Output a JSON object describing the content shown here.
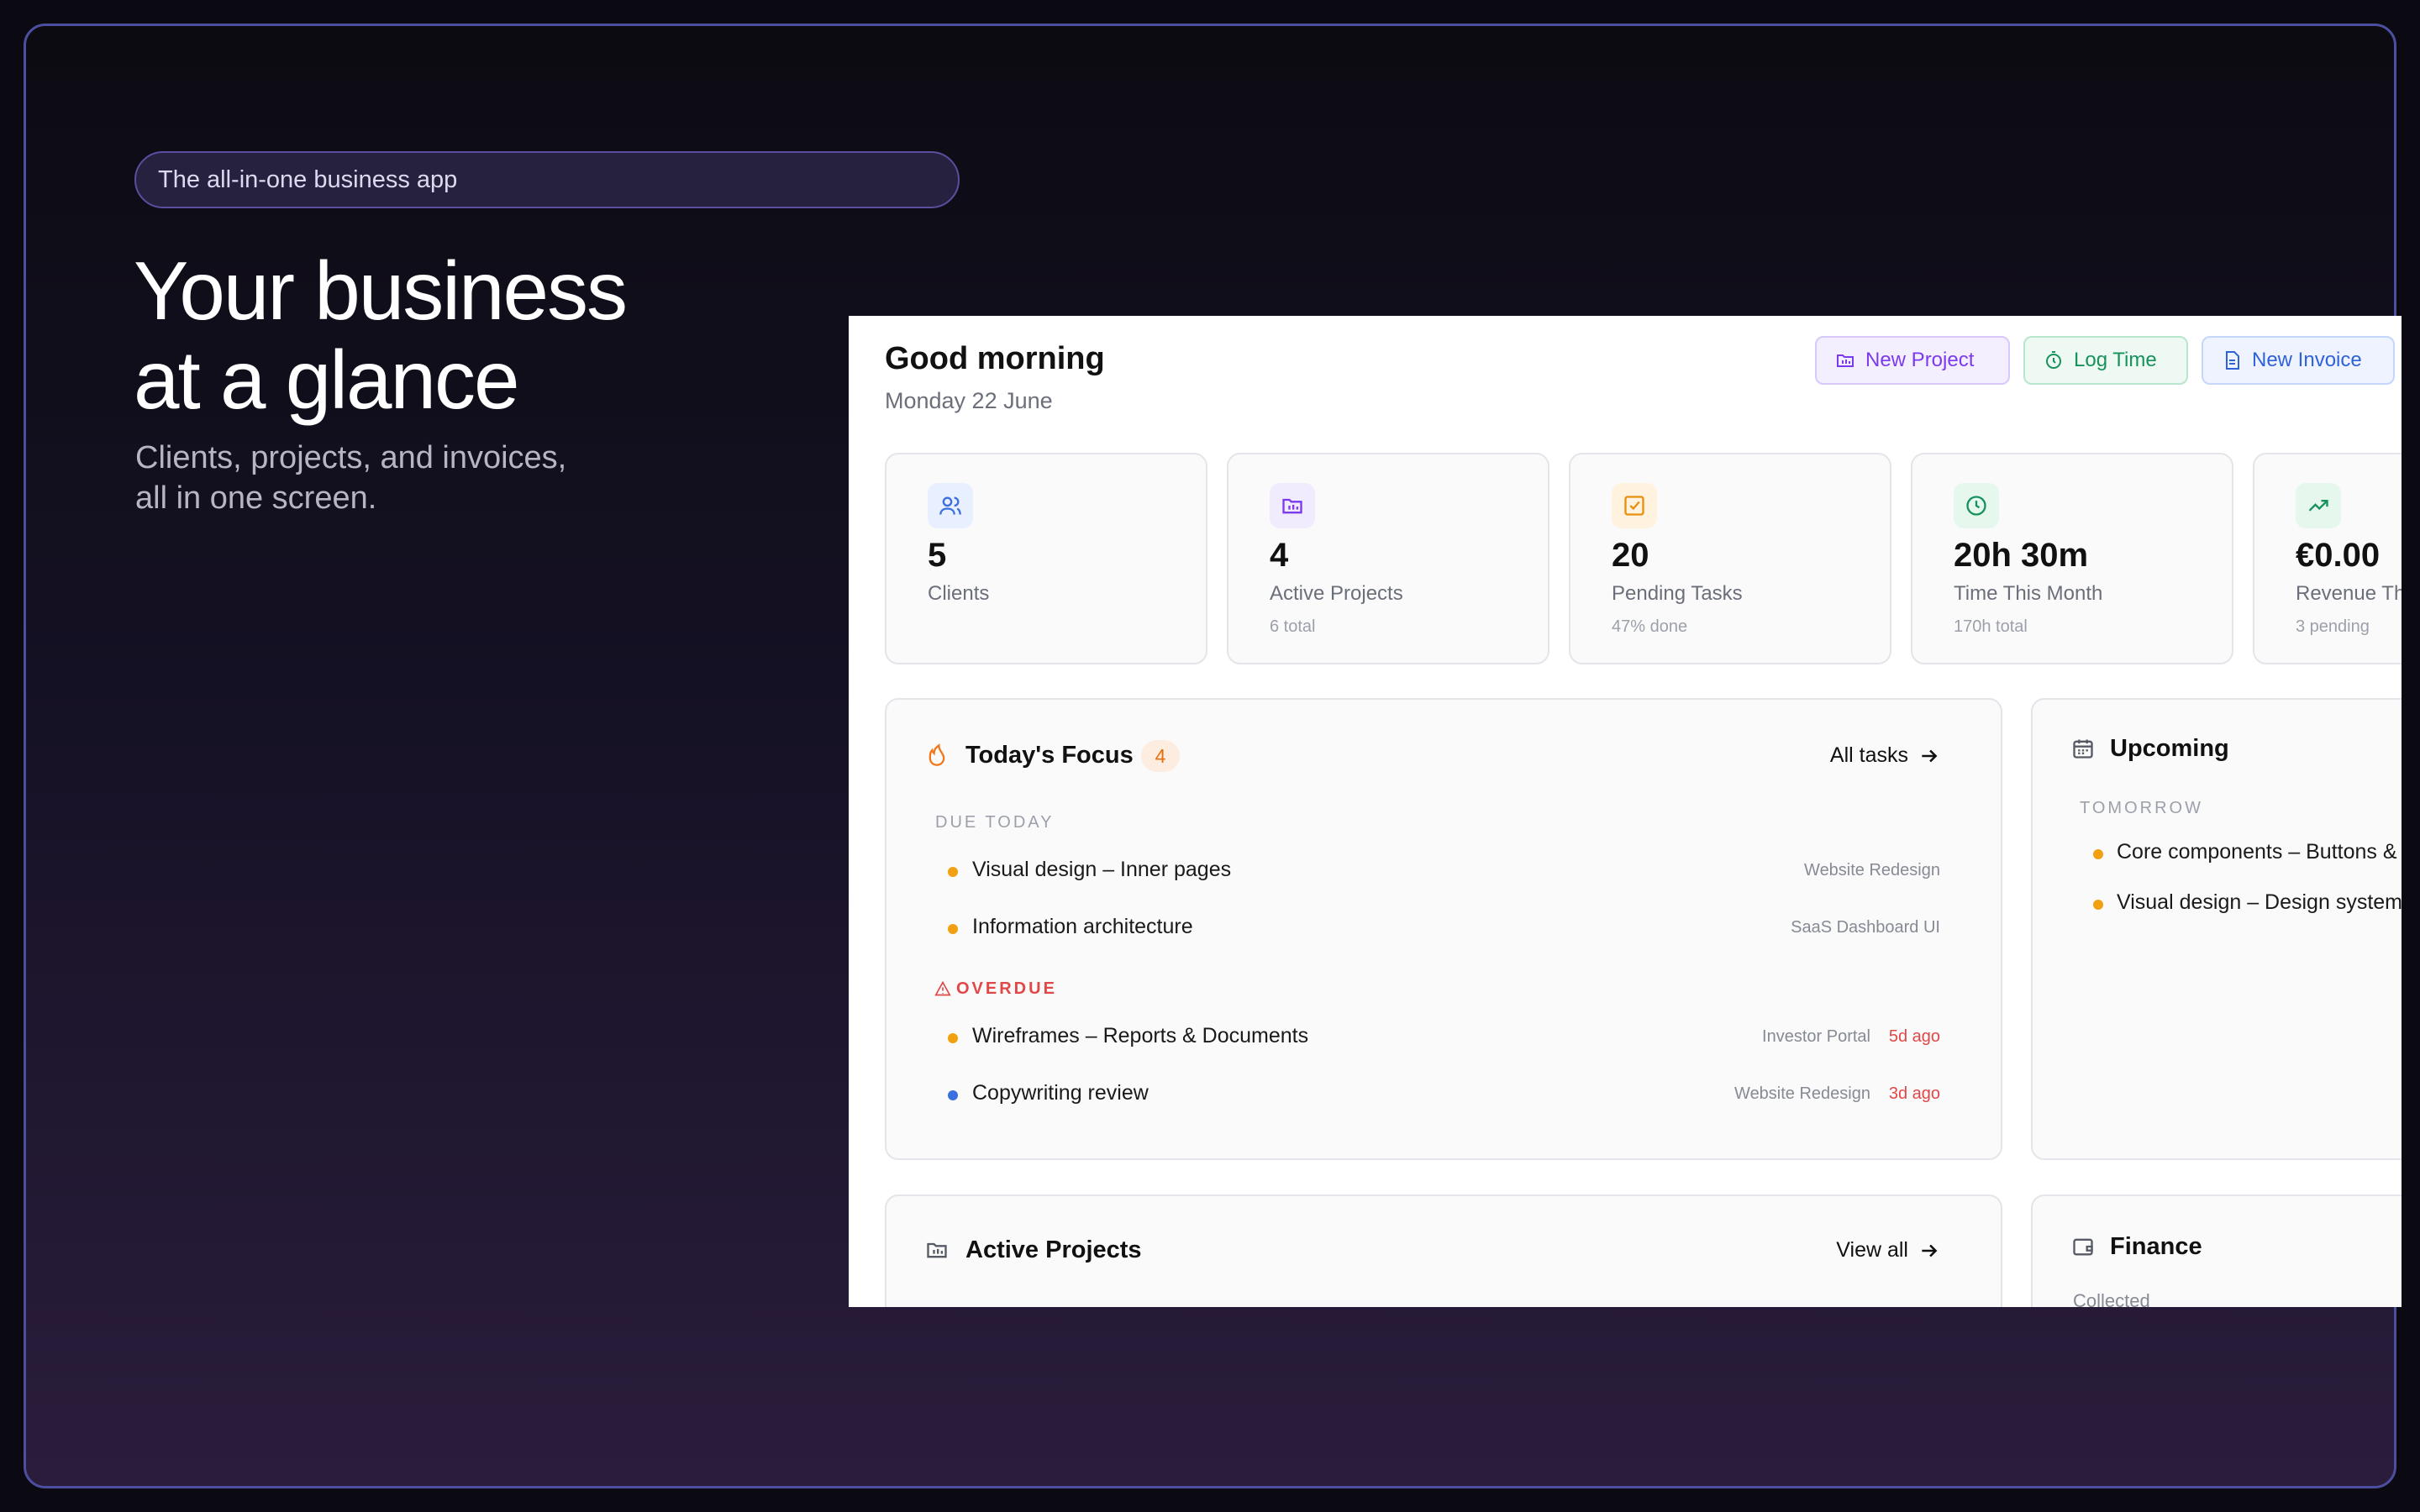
{
  "hero": {
    "pill": "The all-in-one business app",
    "title_line1": "Your business",
    "title_line2": "at a glance",
    "subtitle_line1": "Clients, projects, and invoices,",
    "subtitle_line2": "all in one screen."
  },
  "dashboard": {
    "greeting": "Good morning",
    "date": "Monday 22 June",
    "actions": {
      "new_project": "New Project",
      "log_time": "Log Time",
      "new_invoice": "New Invoice"
    },
    "stats": [
      {
        "value": "5",
        "label": "Clients",
        "sub": "",
        "icon": "users-icon",
        "color": "#3b6fe0"
      },
      {
        "value": "4",
        "label": "Active Projects",
        "sub": "6 total",
        "icon": "folder-icon",
        "color": "#7c3aed"
      },
      {
        "value": "20",
        "label": "Pending Tasks",
        "sub": "47% done",
        "icon": "checkbox-icon",
        "color": "#e8900c"
      },
      {
        "value": "20h 30m",
        "label": "Time This Month",
        "sub": "170h total",
        "icon": "clock-icon",
        "color": "#16925a"
      },
      {
        "value": "€0.00",
        "label": "Revenue Th",
        "sub": "3 pending",
        "icon": "trending-up-icon",
        "color": "#16925a"
      }
    ],
    "focus": {
      "title": "Today's Focus",
      "count": "4",
      "link": "All tasks",
      "due_today_label": "DUE TODAY",
      "due_today": [
        {
          "task": "Visual design – Inner pages",
          "project": "Website Redesign",
          "dot": "#f0a010"
        },
        {
          "task": "Information architecture",
          "project": "SaaS Dashboard UI",
          "dot": "#f0a010"
        }
      ],
      "overdue_label": "OVERDUE",
      "overdue": [
        {
          "task": "Wireframes – Reports & Documents",
          "project": "Investor Portal",
          "ago": "5d ago",
          "dot": "#f0a010"
        },
        {
          "task": "Copywriting review",
          "project": "Website Redesign",
          "ago": "3d ago",
          "dot": "#3b6fe0"
        }
      ]
    },
    "upcoming": {
      "title": "Upcoming",
      "section": "TOMORROW",
      "items": [
        "Core components – Buttons &",
        "Visual design – Design system"
      ]
    },
    "active_projects": {
      "title": "Active Projects",
      "link": "View all"
    },
    "finance": {
      "title": "Finance",
      "collected": "Collected"
    }
  }
}
